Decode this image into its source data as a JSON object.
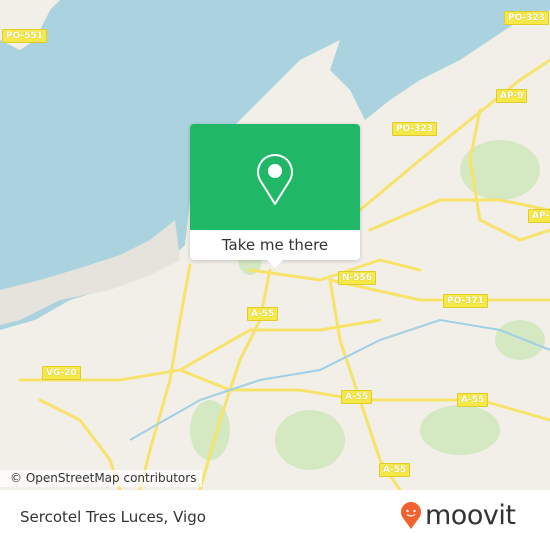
{
  "map": {
    "colors": {
      "water": "#aad3df",
      "land": "#f2efe9",
      "park": "#d4e8c2",
      "road": "#f7e36a",
      "accent": "#20b866"
    },
    "road_labels": [
      "PO-551",
      "PO-323",
      "AP-9",
      "PO-323",
      "AP-",
      "N-556",
      "PO-371",
      "A-55",
      "VG-20",
      "A-55",
      "A-55",
      "A-55"
    ],
    "attribution": "© OpenStreetMap contributors"
  },
  "popup": {
    "icon": "map-pin-icon",
    "button_label": "Take me there"
  },
  "footer": {
    "place_name": "Sercotel Tres Luces, Vigo",
    "brand": "moovit",
    "brand_color": "#f0622e"
  }
}
